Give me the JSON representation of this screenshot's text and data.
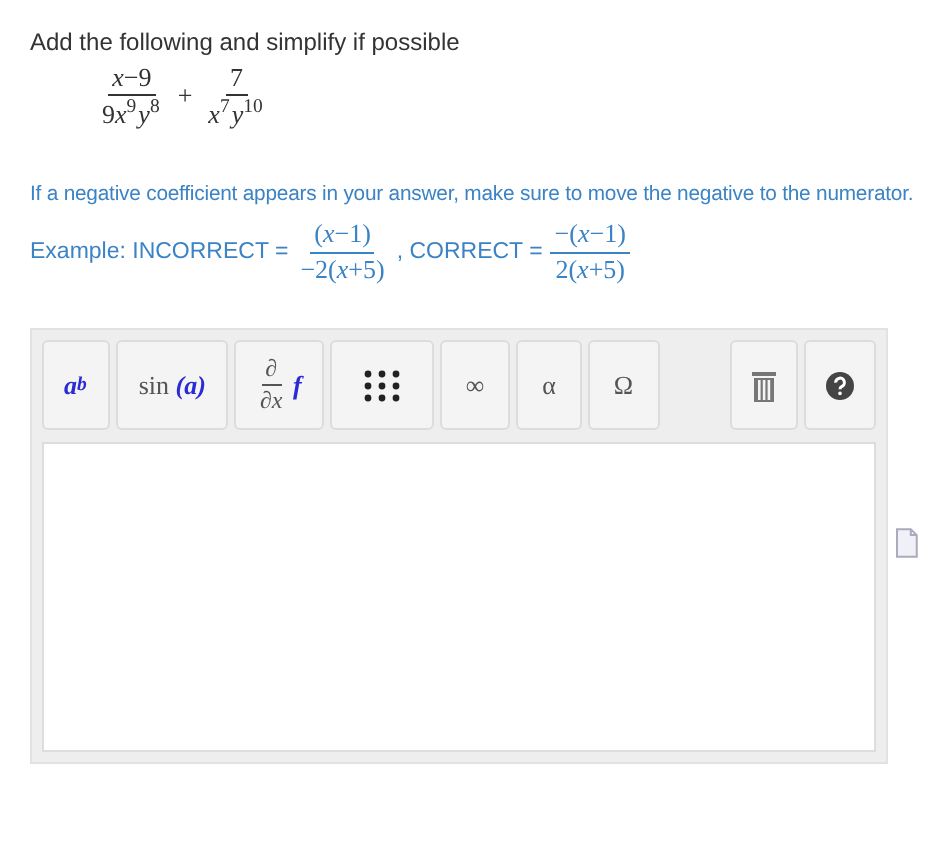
{
  "prompt": "Add the following and simplify if possible",
  "expression": {
    "terms": [
      {
        "numerator": "*x*−9",
        "coefficient": "9",
        "denominator": "*x*$^{9}$*y*$^{8}$"
      },
      {
        "numerator": "7",
        "denominator": "*x*$^{7}$*y*$^{10}$"
      }
    ],
    "operator": "+"
  },
  "note": "If a negative coefficient appears in your answer, make sure to move the negative to the numerator.",
  "example": {
    "label": "Example: INCORRECT =",
    "incorrect": {
      "numerator": "(*x*−1)",
      "denominator": "−2(*x*+5)"
    },
    "separator": ", CORRECT =",
    "correct": {
      "numerator": "−(*x*−1)",
      "denominator": "2(*x*+5)"
    }
  },
  "toolbar": {
    "buttons": [
      {
        "kind": "power",
        "base": "a",
        "exponent": "b"
      },
      {
        "kind": "function",
        "name": "sin",
        "argument": "(a)"
      },
      {
        "kind": "derivative",
        "numerator": "∂",
        "denominator": "∂x",
        "function": "f"
      },
      {
        "kind": "matrix"
      },
      {
        "kind": "symbol",
        "text": "∞"
      },
      {
        "kind": "symbol",
        "text": "α"
      },
      {
        "kind": "symbol",
        "text": "Ω"
      }
    ],
    "actions": [
      {
        "kind": "trash"
      },
      {
        "kind": "help"
      }
    ]
  }
}
